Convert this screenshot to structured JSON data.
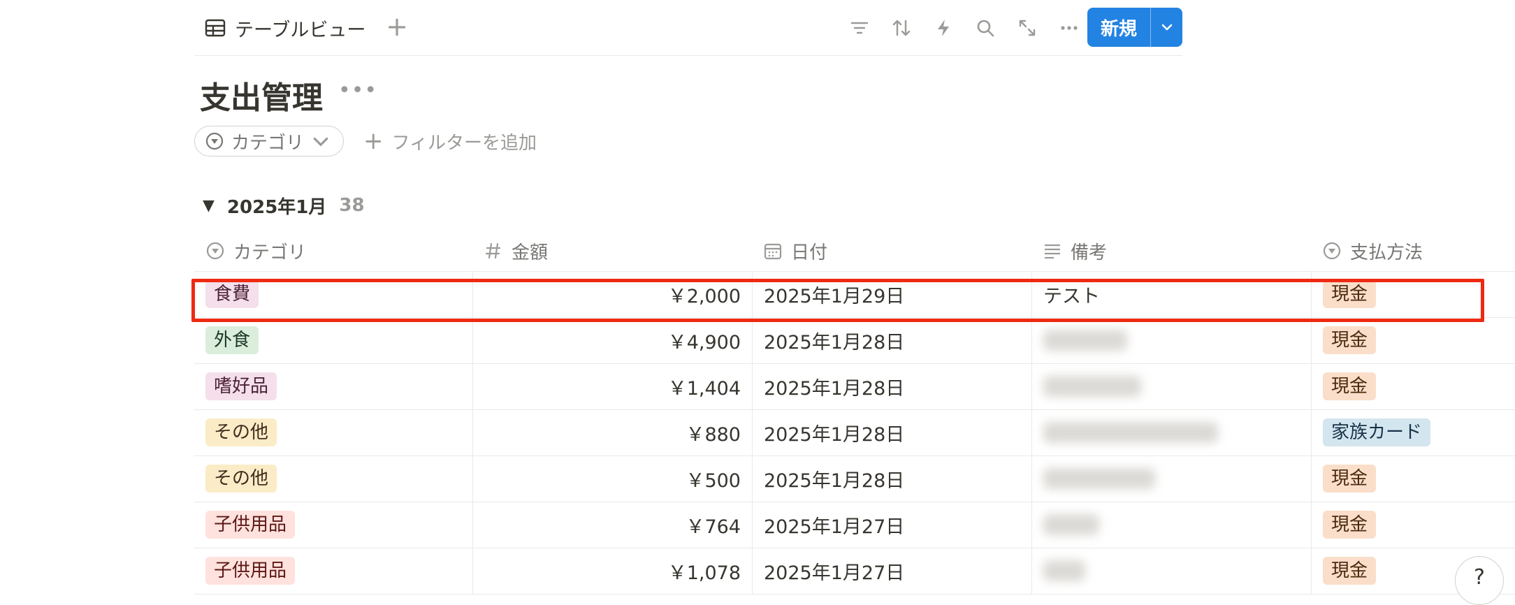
{
  "view": {
    "tab_label": "テーブルビュー",
    "new_label": "新規"
  },
  "page": {
    "title": "支出管理"
  },
  "filters": {
    "chip_label": "カテゴリ",
    "add_filter_label": "フィルターを追加"
  },
  "group": {
    "label": "2025年1月",
    "count": "38"
  },
  "columns": [
    "カテゴリ",
    "金額",
    "日付",
    "備考",
    "支払方法"
  ],
  "colors": {
    "accent": "#2383e2",
    "highlight": "#ee2a12",
    "tag_pink": "#f4dfeb",
    "tag_green": "#dbeddb",
    "tag_yellow": "#fbecc8",
    "tag_red": "#ffe2dd",
    "tag_orange": "#fadec9",
    "tag_blue": "#d3e5ef"
  },
  "rows": [
    {
      "category": "食費",
      "category_color": "pink",
      "amount": "￥2,000",
      "date": "2025年1月29日",
      "note": "テスト",
      "note_hidden": false,
      "method": "現金",
      "method_color": "orange"
    },
    {
      "category": "外食",
      "category_color": "green",
      "amount": "￥4,900",
      "date": "2025年1月28日",
      "note": "",
      "note_hidden": true,
      "method": "現金",
      "method_color": "orange"
    },
    {
      "category": "嗜好品",
      "category_color": "pink",
      "amount": "￥1,404",
      "date": "2025年1月28日",
      "note": "",
      "note_hidden": true,
      "method": "現金",
      "method_color": "orange"
    },
    {
      "category": "その他",
      "category_color": "yellow",
      "amount": "￥880",
      "date": "2025年1月28日",
      "note": "",
      "note_hidden": true,
      "method": "家族カード",
      "method_color": "blue"
    },
    {
      "category": "その他",
      "category_color": "yellow",
      "amount": "￥500",
      "date": "2025年1月28日",
      "note": "",
      "note_hidden": true,
      "method": "現金",
      "method_color": "orange"
    },
    {
      "category": "子供用品",
      "category_color": "red",
      "amount": "￥764",
      "date": "2025年1月27日",
      "note": "",
      "note_hidden": true,
      "method": "現金",
      "method_color": "orange"
    },
    {
      "category": "子供用品",
      "category_color": "red",
      "amount": "￥1,078",
      "date": "2025年1月27日",
      "note": "",
      "note_hidden": true,
      "method": "現金",
      "method_color": "orange"
    }
  ],
  "icons": {
    "view": "table-icon",
    "add": "plus-icon",
    "filter": "filter-icon",
    "sort": "sort-icon",
    "automation": "lightning-icon",
    "search": "search-icon",
    "expand": "expand-icon",
    "more": "more-icon",
    "dropdown": "chevron-down-icon",
    "select_prop": "select-property-icon",
    "number_prop": "number-property-icon",
    "date_prop": "calendar-icon",
    "text_prop": "text-property-icon",
    "help": "help-icon"
  }
}
